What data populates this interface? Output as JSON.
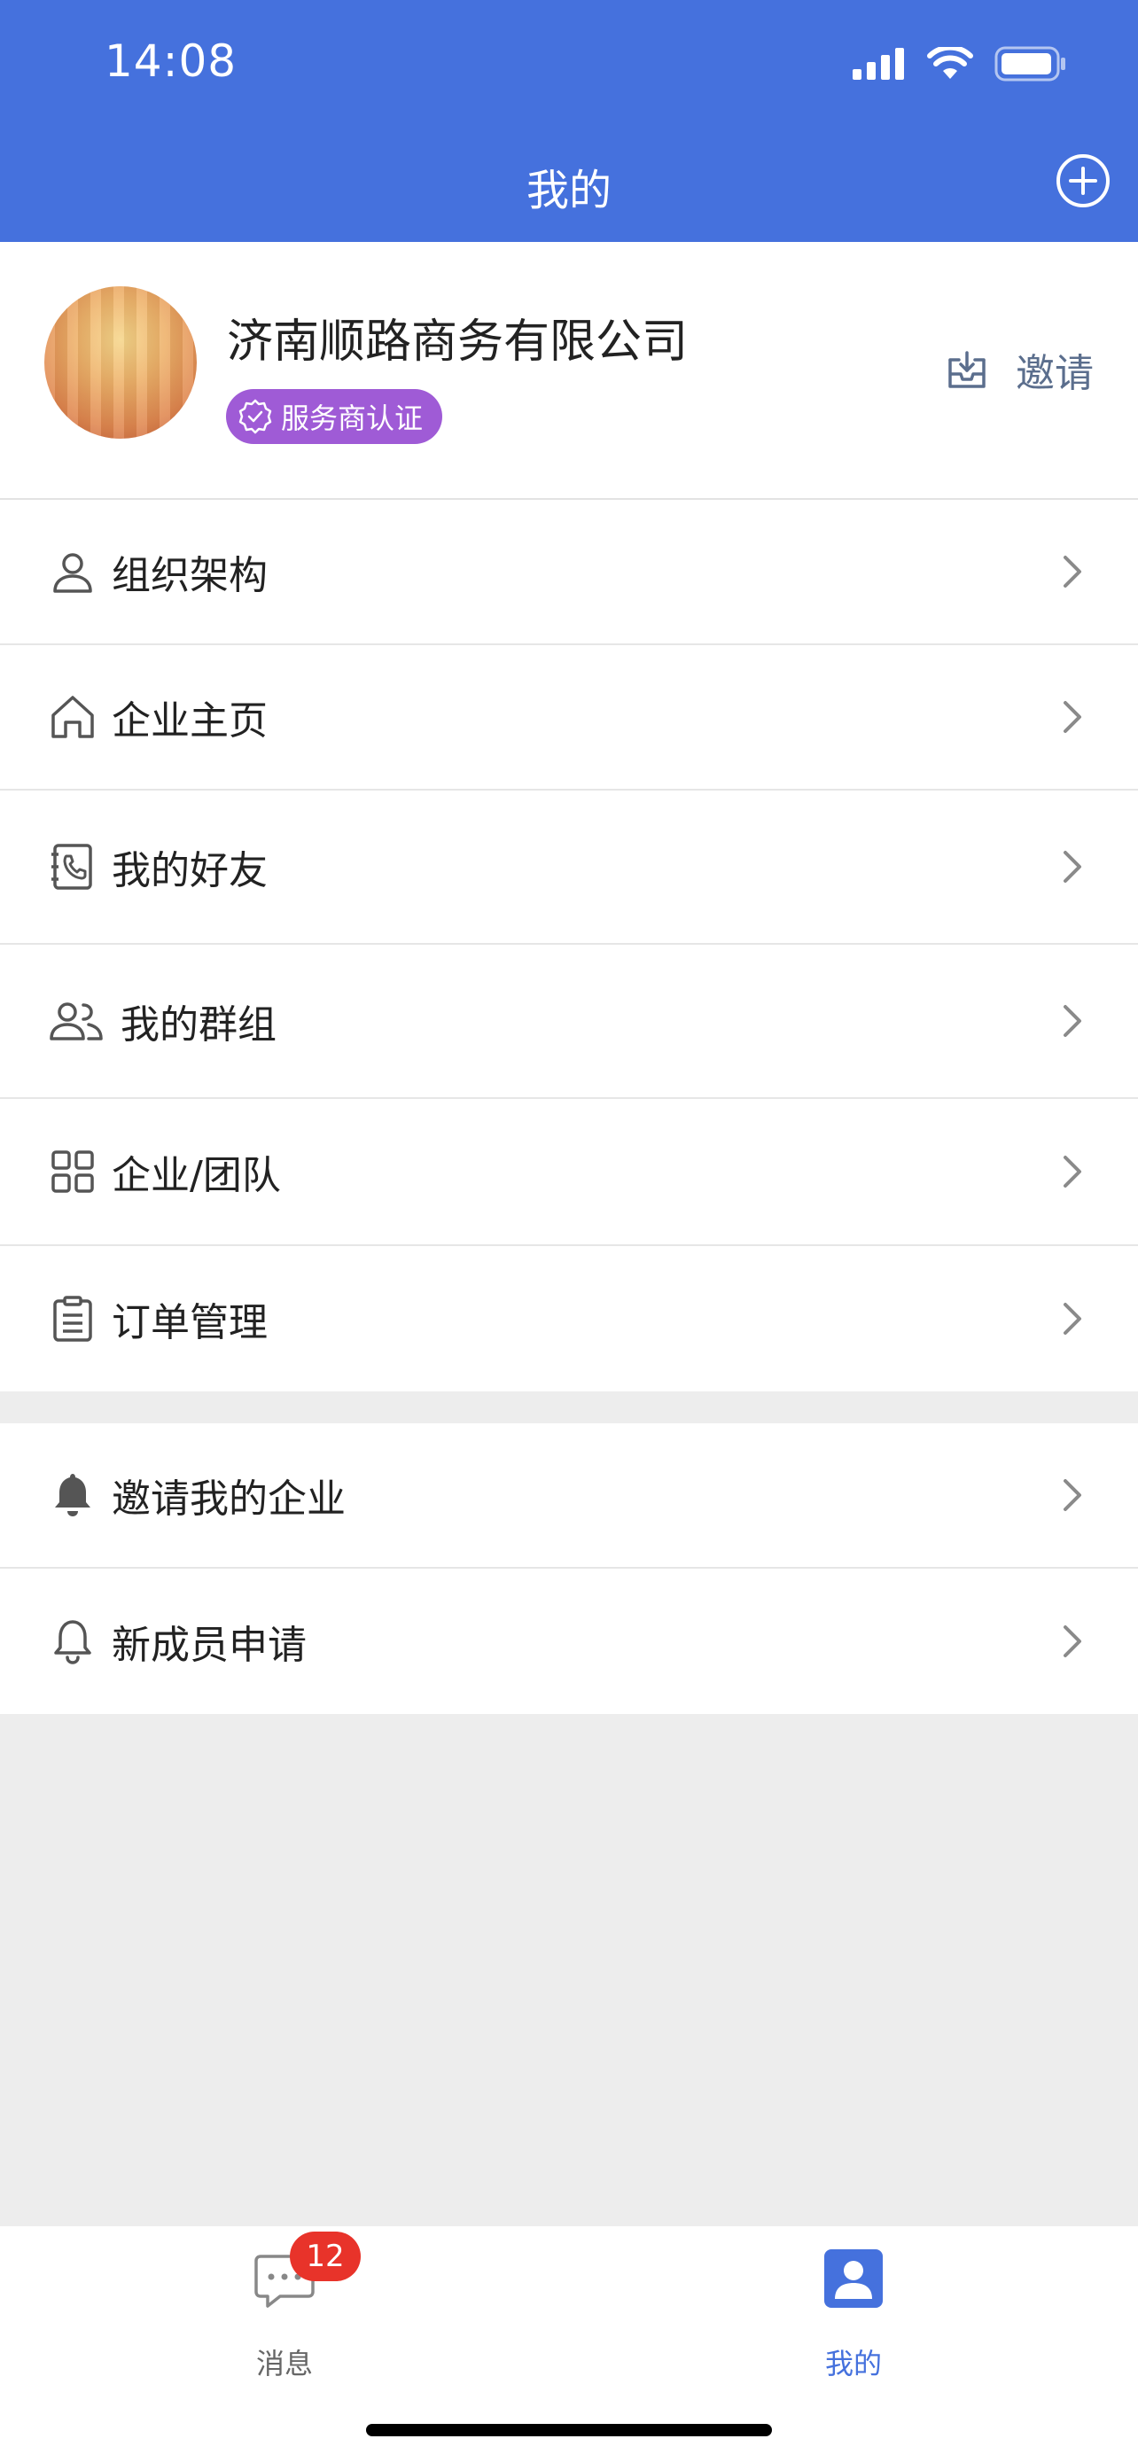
{
  "status": {
    "time": "14:08"
  },
  "nav": {
    "title": "我的"
  },
  "profile": {
    "company": "济南顺路商务有限公司",
    "badge": "服务商认证",
    "invite_label": "邀请"
  },
  "menu1": [
    {
      "label": "组织架构",
      "icon": "person-icon"
    },
    {
      "label": "企业主页",
      "icon": "home-icon"
    },
    {
      "label": "我的好友",
      "icon": "contacts-phone-icon"
    },
    {
      "label": "我的群组",
      "icon": "group-icon"
    },
    {
      "label": "企业/团队",
      "icon": "grid-icon"
    },
    {
      "label": "订单管理",
      "icon": "clipboard-icon"
    }
  ],
  "menu2": [
    {
      "label": "邀请我的企业",
      "icon": "bell-filled-icon"
    },
    {
      "label": "新成员申请",
      "icon": "bell-outline-icon"
    }
  ],
  "tabbar": {
    "messages": {
      "label": "消息",
      "badge": "12"
    },
    "mine": {
      "label": "我的"
    }
  },
  "colors": {
    "primary": "#4571dd",
    "badge_purple": "#9f5bd6",
    "badge_red": "#e8332a"
  }
}
